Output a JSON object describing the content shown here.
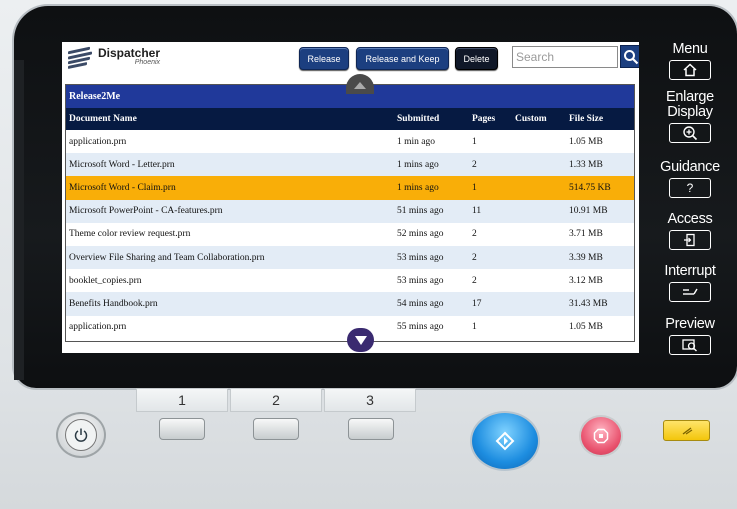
{
  "app": {
    "title": "Dispatcher",
    "subtitle": "Phoenix"
  },
  "toolbar": {
    "release_label": "Release",
    "release_keep_label": "Release and Keep",
    "delete_label": "Delete"
  },
  "search": {
    "placeholder": "Search"
  },
  "table": {
    "title": "Release2Me",
    "columns": [
      "Document Name",
      "Submitted",
      "Pages",
      "Custom",
      "File Size"
    ],
    "rows": [
      {
        "name": "application.prn",
        "submitted": "1 min ago",
        "pages": "1",
        "custom": "",
        "size": "1.05 MB"
      },
      {
        "name": "Microsoft Word - Letter.prn",
        "submitted": "1 mins ago",
        "pages": "2",
        "custom": "",
        "size": "1.33 MB"
      },
      {
        "name": "Microsoft Word - Claim.prn",
        "submitted": "1 mins ago",
        "pages": "1",
        "custom": "",
        "size": "514.75 KB"
      },
      {
        "name": "Microsoft PowerPoint - CA-features.prn",
        "submitted": "51 mins ago",
        "pages": "11",
        "custom": "",
        "size": "10.91 MB"
      },
      {
        "name": "Theme color review request.prn",
        "submitted": "52 mins ago",
        "pages": "2",
        "custom": "",
        "size": "3.71 MB"
      },
      {
        "name": "Overview File Sharing and Team Collaboration.prn",
        "submitted": "53 mins ago",
        "pages": "2",
        "custom": "",
        "size": "3.39 MB"
      },
      {
        "name": "booklet_copies.prn",
        "submitted": "53 mins ago",
        "pages": "2",
        "custom": "",
        "size": "3.12 MB"
      },
      {
        "name": "Benefits Handbook.prn",
        "submitted": "54 mins ago",
        "pages": "17",
        "custom": "",
        "size": "31.43 MB"
      },
      {
        "name": "application.prn",
        "submitted": "55 mins ago",
        "pages": "1",
        "custom": "",
        "size": "1.05 MB"
      }
    ],
    "selected_row": "Microsoft Word - Claim.prn"
  },
  "side_menu": {
    "menu": "Menu",
    "enlarge_1": "Enlarge",
    "enlarge_2": "Display",
    "guidance": "Guidance",
    "guidance_icon": "?",
    "access": "Access",
    "interrupt": "Interrupt",
    "preview": "Preview"
  },
  "keypad": {
    "key1": "1",
    "key2": "2",
    "key3": "3"
  },
  "colors": {
    "header_blue": "#20399a",
    "column_header": "#061a42",
    "selected_row": "#f9ae08",
    "button_blue": "#1c3f80",
    "start": "#1d8de0",
    "stop": "#e8506c",
    "reset": "#f3c60c"
  },
  "icons": [
    "dispatcher-logo-icon",
    "search-icon",
    "scroll-up-icon",
    "scroll-down-icon",
    "home-icon",
    "zoom-in-icon",
    "access-icon",
    "interrupt-icon",
    "preview-icon",
    "power-icon",
    "start-icon",
    "stop-icon",
    "reset-icon"
  ]
}
